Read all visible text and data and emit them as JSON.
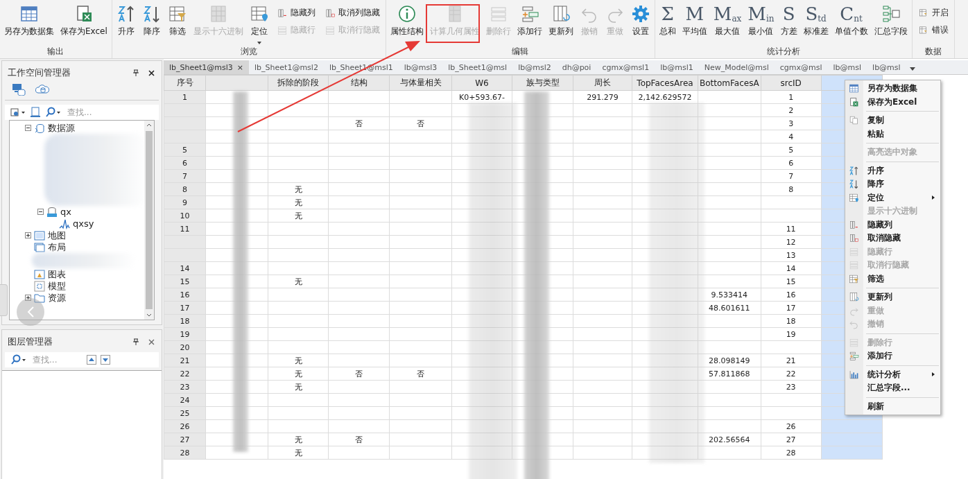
{
  "ribbon": {
    "groups": [
      {
        "label": "输出",
        "items": [
          {
            "kind": "large",
            "label": "另存为数据集",
            "disabled": false
          },
          {
            "kind": "large",
            "label": "保存为Excel",
            "disabled": false
          }
        ]
      },
      {
        "label": "浏览",
        "items": [
          {
            "kind": "large",
            "label": "升序",
            "disabled": false
          },
          {
            "kind": "large",
            "label": "降序",
            "disabled": false
          },
          {
            "kind": "large",
            "label": "筛选",
            "disabled": false
          },
          {
            "kind": "large",
            "label": "显示十六进制",
            "disabled": true
          },
          {
            "kind": "dropdown",
            "label": "定位",
            "disabled": false
          },
          {
            "kind": "stack",
            "buttons": [
              {
                "label": "隐藏列",
                "disabled": false
              },
              {
                "label": "隐藏行",
                "disabled": true
              }
            ]
          },
          {
            "kind": "stack",
            "buttons": [
              {
                "label": "取消列隐藏",
                "disabled": false
              },
              {
                "label": "取消行隐藏",
                "disabled": true
              }
            ]
          }
        ]
      },
      {
        "label": "编辑",
        "items": [
          {
            "kind": "large",
            "label": "属性结构",
            "disabled": false
          },
          {
            "kind": "large",
            "label": "计算几何属性",
            "disabled": true,
            "highlighted": true
          },
          {
            "kind": "large",
            "label": "删除行",
            "disabled": true
          },
          {
            "kind": "large",
            "label": "添加行",
            "disabled": false
          },
          {
            "kind": "large",
            "label": "更新列",
            "disabled": false
          },
          {
            "kind": "large",
            "label": "撤销",
            "disabled": true
          },
          {
            "kind": "large",
            "label": "重做",
            "disabled": true
          },
          {
            "kind": "large",
            "label": "设置",
            "disabled": false
          }
        ]
      },
      {
        "label": "统计分析",
        "items": [
          {
            "kind": "glyph",
            "glyph": "Σ",
            "label": "总和",
            "disabled": false
          },
          {
            "kind": "glyph",
            "glyph": "M",
            "label": "平均值",
            "disabled": false
          },
          {
            "kind": "glyph",
            "glyph": "M",
            "sub": "ax",
            "label": "最大值",
            "disabled": false
          },
          {
            "kind": "glyph",
            "glyph": "M",
            "sub": "in",
            "label": "最小值",
            "disabled": false
          },
          {
            "kind": "glyph",
            "glyph": "S",
            "label": "方差",
            "disabled": false
          },
          {
            "kind": "glyph",
            "glyph": "S",
            "sub": "td",
            "label": "标准差",
            "disabled": false
          },
          {
            "kind": "glyph",
            "glyph": "C",
            "sub": "nt",
            "label": "单值个数",
            "disabled": false
          },
          {
            "kind": "large",
            "label": "汇总字段",
            "disabled": false
          }
        ]
      },
      {
        "label": "数据",
        "items": [
          {
            "kind": "stack",
            "buttons": [
              {
                "label": "开启",
                "disabled": false
              },
              {
                "label": "错误",
                "disabled": false
              }
            ]
          }
        ]
      }
    ]
  },
  "workspace": {
    "title": "工作空间管理器",
    "search_placeholder": "查找...",
    "tree": [
      {
        "kind": "node",
        "label": "数据源",
        "expanded": true,
        "children": [
          {
            "kind": "redacted"
          },
          {
            "kind": "node",
            "label": "qx",
            "expanded": true,
            "children": [
              {
                "kind": "node",
                "label": "qxsy"
              }
            ]
          }
        ]
      },
      {
        "kind": "node",
        "label": "地图",
        "expanded": false
      },
      {
        "kind": "node",
        "label": "布局"
      },
      {
        "kind": "redacted"
      },
      {
        "kind": "node",
        "label": "图表"
      },
      {
        "kind": "node",
        "label": "模型"
      },
      {
        "kind": "node",
        "label": "资源",
        "expanded": false
      }
    ]
  },
  "layers": {
    "title": "图层管理器",
    "search_placeholder": "查找..."
  },
  "tabs": [
    {
      "label": "lb_Sheet1@msl3",
      "selected": true,
      "close": "×"
    },
    {
      "label": "lb_Sheet1@msl2",
      "selected": false
    },
    {
      "label": "lb_Sheet1@msl1",
      "selected": false
    },
    {
      "label": "lb@msl3",
      "selected": false
    },
    {
      "label": "lb_Sheet1@msl",
      "selected": false
    },
    {
      "label": "lb@msl2",
      "selected": false
    },
    {
      "label": "dh@poi",
      "selected": false
    },
    {
      "label": "cgmx@msl1",
      "selected": false
    },
    {
      "label": "lb@msl1",
      "selected": false
    },
    {
      "label": "New_Model@msl",
      "selected": false
    },
    {
      "label": "cgmx@msl",
      "selected": false
    },
    {
      "label": "lb@msl",
      "selected": false
    },
    {
      "label": "lb@msl",
      "selected": false
    }
  ],
  "table": {
    "columns": [
      {
        "label": "序号",
        "selected": false
      },
      {
        "selected": false
      },
      {
        "label": "拆除的阶段",
        "selected": false
      },
      {
        "label": "结构",
        "selected": false
      },
      {
        "label": "与体量相关",
        "selected": false
      },
      {
        "label": "W6",
        "selected": false
      },
      {
        "label": "族与类型",
        "selected": false
      },
      {
        "label": "周长",
        "selected": false
      },
      {
        "label": "TopFacesArea",
        "selected": false
      },
      {
        "label": "BottomFacesA",
        "selected": false
      },
      {
        "label": "srcID",
        "selected": false
      },
      {
        "selected": true
      }
    ],
    "rows": [
      {
        "number": "1",
        "cells": {
          "5": "K0+593.67-",
          "7": "291.279",
          "8": "2,142.629572"
        },
        "src_id": "1"
      },
      {
        "cells": {},
        "src_id": "2"
      },
      {
        "cells": {
          "3": "否",
          "4": "否"
        },
        "src_id": "3"
      },
      {
        "cells": {},
        "src_id": "4"
      },
      {
        "number": "5",
        "cells": {},
        "src_id": "5"
      },
      {
        "number": "6",
        "cells": {},
        "src_id": "6"
      },
      {
        "number": "7",
        "cells": {},
        "src_id": "7"
      },
      {
        "number": "8",
        "cells": {
          "2": "无"
        },
        "src_id": "8"
      },
      {
        "number": "9",
        "cells": {
          "2": "无"
        }
      },
      {
        "number": "10",
        "cells": {
          "2": "无"
        }
      },
      {
        "number": "11",
        "cells": {},
        "src_id": "11"
      },
      {
        "cells": {},
        "src_id": "12"
      },
      {
        "cells": {},
        "src_id": "13"
      },
      {
        "number": "14",
        "cells": {},
        "src_id": "14"
      },
      {
        "number": "15",
        "cells": {
          "2": "无"
        },
        "src_id": "15"
      },
      {
        "number": "16",
        "cells": {
          "9": "9.533414"
        },
        "src_id": "16"
      },
      {
        "number": "17",
        "cells": {
          "9": "48.601611"
        },
        "src_id": "17"
      },
      {
        "number": "18",
        "cells": {},
        "src_id": "18"
      },
      {
        "number": "19",
        "cells": {},
        "src_id": "19"
      },
      {
        "number": "20",
        "cells": {}
      },
      {
        "number": "21",
        "cells": {
          "2": "无",
          "9": "28.098149"
        },
        "src_id": "21"
      },
      {
        "number": "22",
        "cells": {
          "2": "无",
          "3": "否",
          "4": "否",
          "9": "57.811868"
        },
        "src_id": "22"
      },
      {
        "number": "23",
        "cells": {
          "2": "无"
        },
        "src_id": "23"
      },
      {
        "number": "24",
        "cells": {}
      },
      {
        "number": "25",
        "cells": {}
      },
      {
        "number": "26",
        "cells": {},
        "src_id": "26"
      },
      {
        "number": "27",
        "cells": {
          "2": "无",
          "3": "否",
          "9": "202.56564"
        },
        "src_id": "27"
      },
      {
        "number": "28",
        "cells": {
          "2": "无"
        },
        "src_id": "28"
      }
    ]
  },
  "context_menu": [
    {
      "kind": "item",
      "label": "另存为数据集",
      "disabled": false
    },
    {
      "kind": "item",
      "label": "保存为Excel",
      "disabled": false
    },
    {
      "kind": "separator"
    },
    {
      "kind": "item",
      "label": "复制",
      "disabled": false
    },
    {
      "kind": "item",
      "label": "粘贴",
      "disabled": false
    },
    {
      "kind": "separator"
    },
    {
      "kind": "item",
      "label": "高亮选中对象",
      "disabled": true
    },
    {
      "kind": "separator"
    },
    {
      "kind": "item",
      "label": "升序",
      "disabled": false
    },
    {
      "kind": "item",
      "label": "降序",
      "disabled": false
    },
    {
      "kind": "submenu",
      "label": "定位",
      "disabled": false
    },
    {
      "kind": "item",
      "label": "显示十六进制",
      "disabled": true
    },
    {
      "kind": "item",
      "label": "隐藏列",
      "disabled": false
    },
    {
      "kind": "item",
      "label": "取消隐藏",
      "disabled": false
    },
    {
      "kind": "item",
      "label": "隐藏行",
      "disabled": true
    },
    {
      "kind": "item",
      "label": "取消行隐藏",
      "disabled": true
    },
    {
      "kind": "item",
      "label": "筛选",
      "disabled": false
    },
    {
      "kind": "separator"
    },
    {
      "kind": "item",
      "label": "更新列",
      "disabled": false
    },
    {
      "kind": "item",
      "label": "重做",
      "disabled": true
    },
    {
      "kind": "item",
      "label": "撤销",
      "disabled": true
    },
    {
      "kind": "separator"
    },
    {
      "kind": "item",
      "label": "删除行",
      "disabled": true
    },
    {
      "kind": "item",
      "label": "添加行",
      "disabled": false
    },
    {
      "kind": "separator"
    },
    {
      "kind": "submenu",
      "label": "统计分析",
      "disabled": false
    },
    {
      "kind": "item",
      "label": "汇总字段...",
      "disabled": false
    },
    {
      "kind": "separator"
    },
    {
      "kind": "item",
      "label": "刷新",
      "disabled": false
    }
  ]
}
